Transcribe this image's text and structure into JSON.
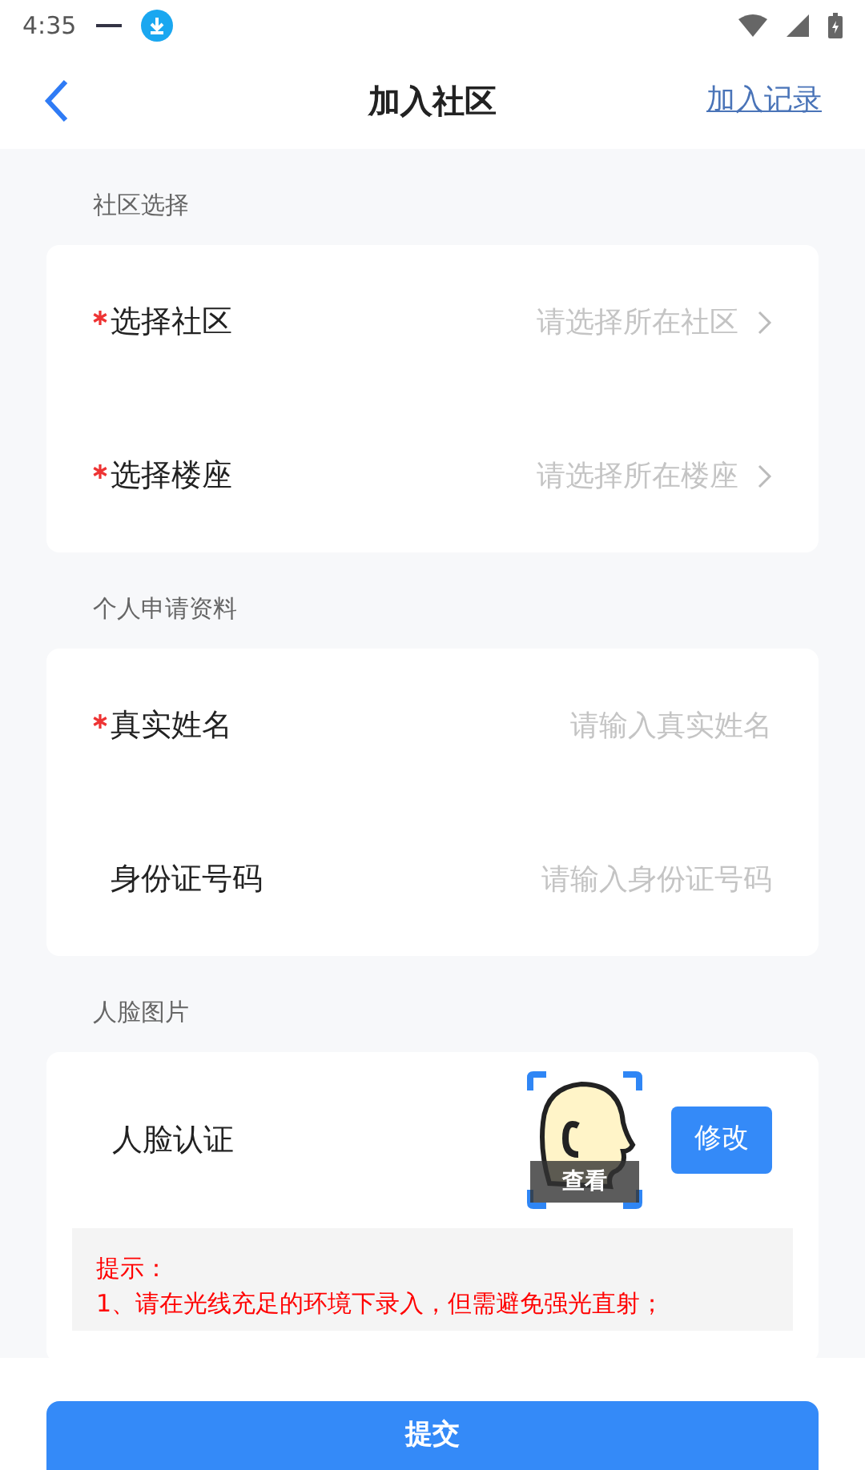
{
  "status_bar": {
    "time": "4:35"
  },
  "header": {
    "title": "加入社区",
    "action": "加入记录"
  },
  "sections": [
    {
      "label": "社区选择",
      "rows": [
        {
          "kind": "select",
          "label": "选择社区",
          "required": true,
          "placeholder": "请选择所在社区"
        },
        {
          "kind": "select",
          "label": "选择楼座",
          "required": true,
          "placeholder": "请选择所在楼座"
        }
      ]
    },
    {
      "label": "个人申请资料",
      "rows": [
        {
          "kind": "input",
          "label": "真实姓名",
          "required": true,
          "placeholder": "请输入真实姓名"
        },
        {
          "kind": "input",
          "label": "身份证号码",
          "required": false,
          "placeholder": "请输入身份证号码"
        }
      ]
    },
    {
      "label": "人脸图片",
      "face": {
        "label": "人脸认证",
        "view": "查看",
        "edit": "修改"
      },
      "tips": [
        "提示：",
        "1、请在光线充足的环境下录入，但需避免强光直射；"
      ]
    }
  ],
  "submit": "提交"
}
